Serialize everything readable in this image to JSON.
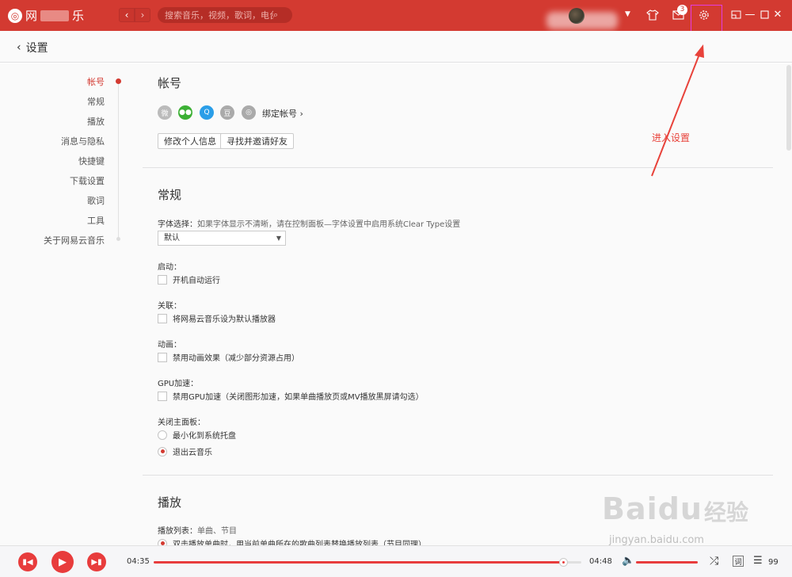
{
  "app": {
    "logo_text": "网",
    "logo_text_end": "乐",
    "search_placeholder": "搜索音乐，视频，歌词，电台",
    "message_count": "3",
    "brand_color": "#d33a31"
  },
  "header": {
    "back_label": "设置"
  },
  "sidebar": {
    "items": [
      {
        "label": "帐号",
        "active": true
      },
      {
        "label": "常规"
      },
      {
        "label": "播放"
      },
      {
        "label": "消息与隐私"
      },
      {
        "label": "快捷键"
      },
      {
        "label": "下载设置"
      },
      {
        "label": "歌词"
      },
      {
        "label": "工具"
      },
      {
        "label": "关于网易云音乐"
      }
    ]
  },
  "account": {
    "title": "帐号",
    "bind_link": "绑定帐号 ›",
    "edit_profile": "修改个人信息",
    "invite_friends": "寻找并邀请好友",
    "social_icons": [
      "weibo-icon",
      "wechat-icon",
      "qq-icon",
      "douban-icon",
      "netease-icon"
    ]
  },
  "general": {
    "title": "常规",
    "font_label": "字体选择：",
    "font_hint": "如果字体显示不清晰，请在控制面板—字体设置中启用系统Clear Type设置",
    "font_value": "默认",
    "startup_label": "启动：",
    "startup_option": "开机自动运行",
    "assoc_label": "关联：",
    "assoc_option": "将网易云音乐设为默认播放器",
    "anim_label": "动画：",
    "anim_option": "禁用动画效果（减少部分资源占用）",
    "gpu_label": "GPU加速：",
    "gpu_option": "禁用GPU加速（关闭图形加速，如果单曲播放页或MV播放黑屏请勾选）",
    "close_label": "关闭主面板：",
    "close_opt1": "最小化到系统托盘",
    "close_opt2": "退出云音乐"
  },
  "play": {
    "title": "播放",
    "playlist_label": "播放列表：",
    "playlist_hint": "单曲、节目",
    "playlist_option": "双击播放单曲时，用当前单曲所在的歌曲列表替换播放列表（节目同理）"
  },
  "annotation": {
    "text": "进入设置"
  },
  "watermark": {
    "logo": "Baidu",
    "text": "经验",
    "url": "jingyan.baidu.com"
  },
  "player": {
    "current_time": "04:35",
    "total_time": "04:48",
    "progress": 0.96,
    "volume": 1.0,
    "lyric_label": "词",
    "playlist_count": "99"
  }
}
